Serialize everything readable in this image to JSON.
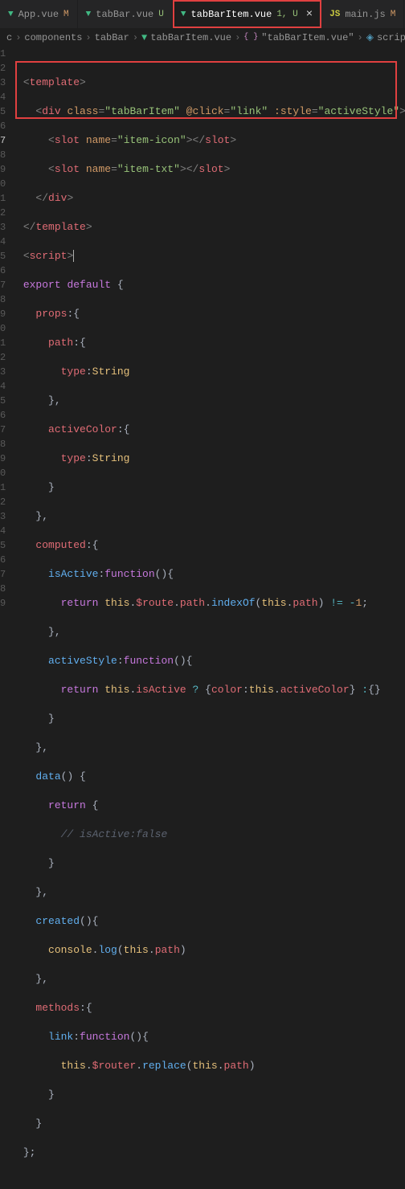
{
  "tabs": [
    {
      "icon": "vue",
      "label": "App.vue",
      "modifier": "M",
      "mod_class": "mod"
    },
    {
      "icon": "vue",
      "label": "tabBar.vue",
      "modifier": "U",
      "mod_class": "mod-u"
    },
    {
      "icon": "vue",
      "label": "tabBarItem.vue",
      "modifier": "1, U",
      "mod_class": "mod-u",
      "active": true,
      "highlighted": true,
      "closable": true
    },
    {
      "icon": "js",
      "label": "main.js",
      "modifier": "M",
      "mod_class": "mod"
    }
  ],
  "breadcrumb": {
    "p0": "c",
    "p1": "components",
    "p2": "tabBar",
    "p3": "tabBarItem.vue",
    "p4": "\"tabBarItem.vue\"",
    "p5": "script"
  },
  "lines": [
    "1",
    "2",
    "3",
    "4",
    "5",
    "6",
    "7",
    "8",
    "9",
    "0",
    "1",
    "2",
    "3",
    "4",
    "5",
    "6",
    "7",
    "8",
    "9",
    "0",
    "1",
    "2",
    "3",
    "4",
    "5",
    "6",
    "7",
    "8",
    "9",
    "0",
    "1",
    "2",
    "3",
    "4",
    "5",
    "6",
    "7",
    "8",
    "9"
  ],
  "active_line": 7,
  "code": {
    "template": "template",
    "div": "div",
    "class": "class",
    "classv": "tabBarItem",
    "click": "@click",
    "clickv": "link",
    "style": ":style",
    "stylev": "activeStyle",
    "slot": "slot",
    "name": "name",
    "slot1v": "item-icon",
    "slot2v": "item-txt",
    "script": "script",
    "export": "export",
    "default": "default",
    "props": "props",
    "path": "path",
    "type": "type",
    "String": "String",
    "activeColor": "activeColor",
    "computed": "computed",
    "isActive": "isActive",
    "function": "function",
    "return": "return",
    "this": "this",
    "route": "$route",
    "pathp": "path",
    "indexOf": "indexOf",
    "neg1": "1",
    "activeStyle": "activeStyle",
    "color": "color",
    "data": "data",
    "cmt": "// isActive:false",
    "created": "created",
    "console": "console",
    "log": "log",
    "methods": "methods",
    "link": "link",
    "router": "$router",
    "replace": "replace"
  }
}
